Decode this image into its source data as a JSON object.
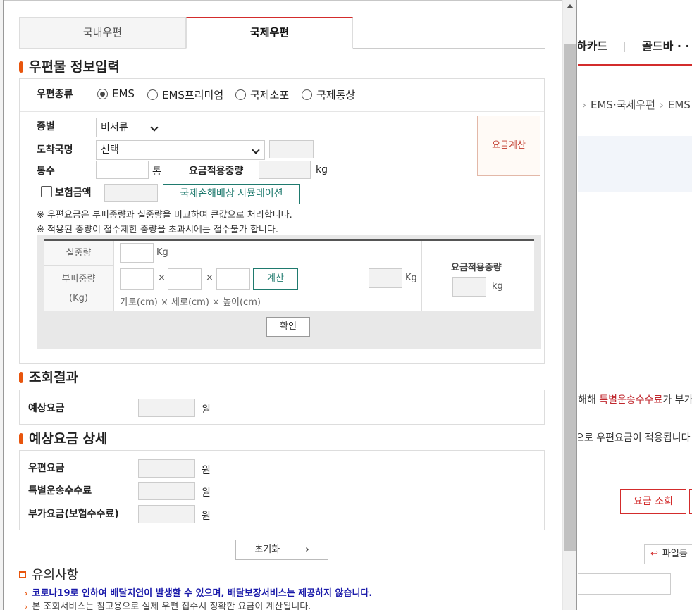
{
  "background": {
    "nav": [
      "하카드",
      "골드바 · ·"
    ],
    "breadcrumb": [
      "EMS·국제우편",
      "EMS"
    ],
    "text_line1_prefix": "해해 ",
    "text_line1_red": "특별운송수수료",
    "text_line1_suffix": "가 부가",
    "text_line2": "으로 우편요금이 적용됩니다",
    "rate_button": "요금 조회",
    "file_button": "파일등"
  },
  "tabs": [
    {
      "label": "국내우편",
      "active": false
    },
    {
      "label": "국제우편",
      "active": true
    }
  ],
  "section_input": {
    "title": "우편물 정보입력",
    "mail_type_label": "우편종류",
    "mail_type_options": [
      {
        "label": "EMS",
        "checked": true
      },
      {
        "label": "EMS프리미엄",
        "checked": false
      },
      {
        "label": "국제소포",
        "checked": false
      },
      {
        "label": "국제통상",
        "checked": false
      }
    ],
    "kind_label": "종별",
    "kind_value": "비서류",
    "country_label": "도착국명",
    "country_value": "선택",
    "count_label": "통수",
    "count_unit": "통",
    "applied_weight_label": "요금적용중량",
    "applied_weight_unit": "kg",
    "insurance_label": "보험금액",
    "simulation_button": "국제손해배상 시뮬레이션",
    "calc_button": "요금계산",
    "notes": [
      "※ 우편요금은 부피중량과 실중량을 비교하여 큰값으로 처리합니다.",
      "※ 적용된 중량이 접수제한 중량을 초과시에는 접수불가 합니다."
    ],
    "weight_table": {
      "actual_label": "실중량",
      "actual_unit": "Kg",
      "volume_label_1": "부피중량",
      "volume_label_2": "(Kg)",
      "times_sign": "×",
      "compute_button": "계산",
      "volume_unit": "Kg",
      "dims_hint": "가로(cm) × 세로(cm) × 높이(cm)",
      "applied_label": "요금적용중량",
      "applied_unit": "kg",
      "confirm_button": "확인"
    }
  },
  "section_result": {
    "title": "조회결과",
    "expected_fee_label": "예상요금",
    "unit": "원"
  },
  "section_detail": {
    "title": "예상요금 상세",
    "rows": [
      {
        "label": "우편요금",
        "unit": "원"
      },
      {
        "label": "특별운송수수료",
        "unit": "원"
      },
      {
        "label": "부가요금(보험수수료)",
        "unit": "원"
      }
    ]
  },
  "reset_button": "초기화",
  "notice": {
    "title": "유의사항",
    "items": [
      "코로나19로 인하여 배달지연이 발생할 수 있으며, 배달보장서비스는 제공하지 않습니다.",
      "본 조회서비스는 참고용으로 실제 우편 접수시 정확한 요금이 계산됩니다."
    ]
  }
}
